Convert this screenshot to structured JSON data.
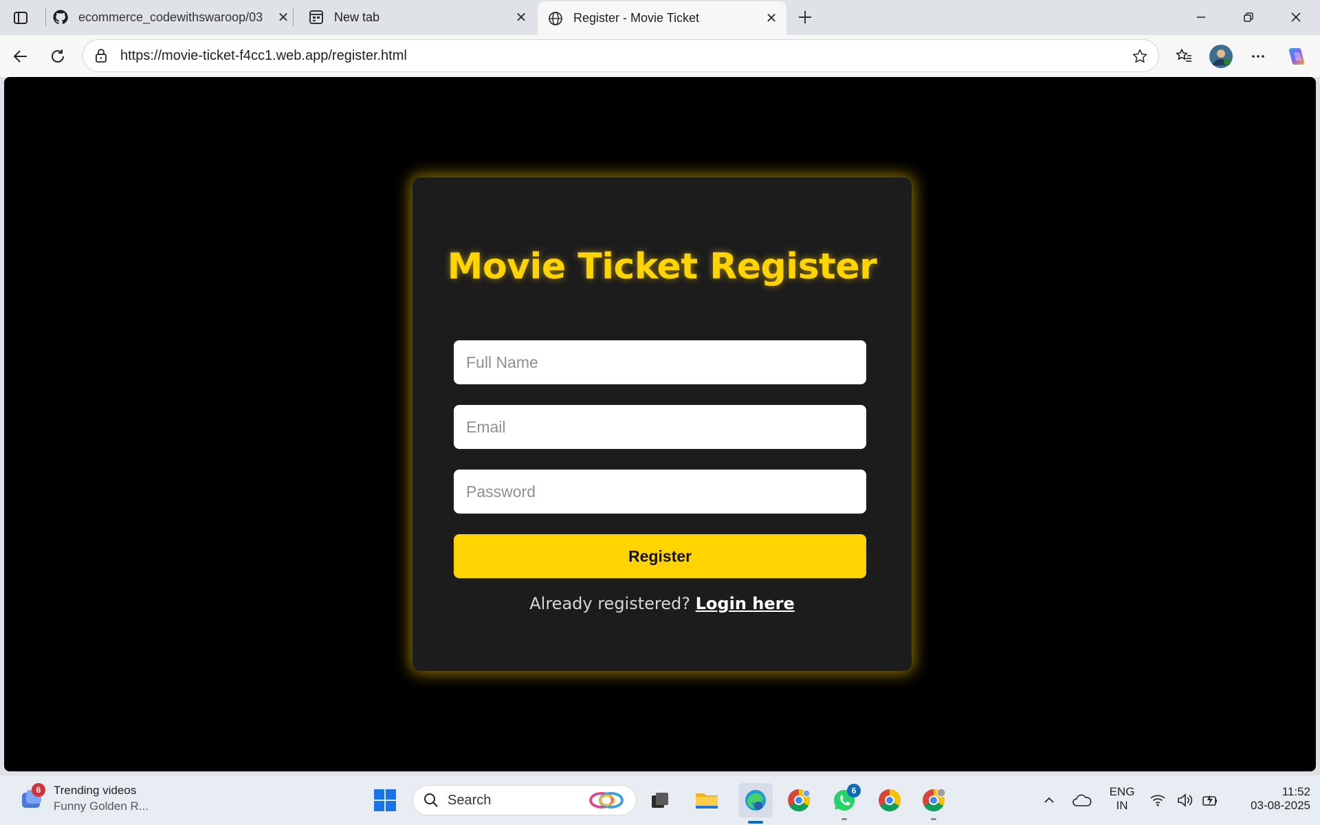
{
  "browser": {
    "tabs": [
      {
        "label": "ecommerce_codewithswaroop/03",
        "favicon": "github-icon"
      },
      {
        "label": "New tab",
        "favicon": "newtab-icon"
      },
      {
        "label": "Register - Movie Ticket",
        "favicon": "globe-icon",
        "active": true
      }
    ],
    "url": "https://movie-ticket-f4cc1.web.app/register.html"
  },
  "page": {
    "title": "Movie Ticket Register",
    "fields": {
      "full_name_placeholder": "Full Name",
      "email_placeholder": "Email",
      "password_placeholder": "Password"
    },
    "register_label": "Register",
    "login_prompt": "Already registered?",
    "login_link": "Login here"
  },
  "taskbar": {
    "widget": {
      "title": "Trending videos",
      "subtitle": "Funny Golden R...",
      "badge": "6"
    },
    "search_label": "Search",
    "whatsapp_badge": "6",
    "lang_line1": "ENG",
    "lang_line2": "IN",
    "time": "11:52",
    "date": "03-08-2025"
  },
  "colors": {
    "accent": "#ffd400",
    "card_bg": "#1c1c1c",
    "page_bg": "#000000"
  }
}
